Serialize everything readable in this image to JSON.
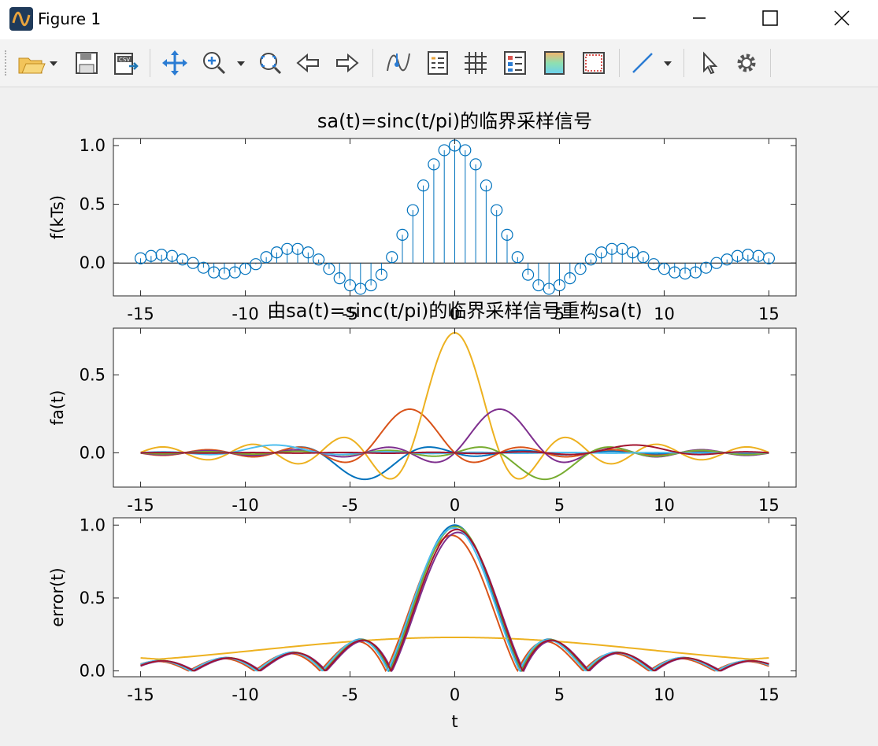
{
  "window": {
    "title": "Figure 1"
  },
  "toolbar": {
    "buttons": [
      "open-file-icon",
      "dropdown-arrow-icon",
      "save-icon",
      "export-csv-icon",
      "pan-icon",
      "zoom-in-icon",
      "dropdown-arrow-icon",
      "zoom-fit-icon",
      "back-arrow-icon",
      "forward-arrow-icon",
      "data-tip-icon",
      "legend-icon",
      "grid-icon",
      "property-inspector-icon",
      "colorbar-icon",
      "axes-box-icon",
      "line-tool-icon",
      "dropdown-arrow-icon",
      "select-pointer-icon",
      "settings-gear-icon"
    ],
    "csv_text": "CSV"
  },
  "colors": {
    "stem": "#0072bd",
    "series": [
      "#0072bd",
      "#d95319",
      "#edb120",
      "#7e2f8e",
      "#77ac30",
      "#4dbeee",
      "#a2142f"
    ]
  },
  "chart_data": [
    {
      "type": "stem",
      "title": "sa(t)=sinc(t/pi)的临界采样信号",
      "xlabel": "",
      "ylabel": "f(kTs)",
      "xlim": [
        -16.3,
        16.3
      ],
      "ylim": [
        -0.28,
        1.06
      ],
      "xticks": [
        -15,
        -10,
        -5,
        0,
        5,
        10,
        15
      ],
      "yticks": [
        0.0,
        0.5,
        1.0
      ],
      "ytick_labels": [
        "0.0",
        "0.5",
        "1.0"
      ],
      "x": [
        -15,
        -14.5,
        -14,
        -13.5,
        -13,
        -12.5,
        -12,
        -11.5,
        -11,
        -10.5,
        -10,
        -9.5,
        -9,
        -8.5,
        -8,
        -7.5,
        -7,
        -6.5,
        -6,
        -5.5,
        -5,
        -4.5,
        -4,
        -3.5,
        -3,
        -2.5,
        -2,
        -1.5,
        -1,
        -0.5,
        0,
        0.5,
        1,
        1.5,
        2,
        2.5,
        3,
        3.5,
        4,
        4.5,
        5,
        5.5,
        6,
        6.5,
        7,
        7.5,
        8,
        8.5,
        9,
        9.5,
        10,
        10.5,
        11,
        11.5,
        12,
        12.5,
        13,
        13.5,
        14,
        14.5,
        15
      ],
      "values": [
        0.04,
        0.06,
        0.07,
        0.06,
        0.03,
        0.0,
        -0.04,
        -0.08,
        -0.09,
        -0.08,
        -0.05,
        -0.01,
        0.05,
        0.09,
        0.12,
        0.12,
        0.09,
        0.03,
        -0.05,
        -0.13,
        -0.19,
        -0.22,
        -0.19,
        -0.1,
        0.05,
        0.24,
        0.45,
        0.66,
        0.84,
        0.96,
        1.0,
        0.96,
        0.84,
        0.66,
        0.45,
        0.24,
        0.05,
        -0.1,
        -0.19,
        -0.22,
        -0.19,
        -0.13,
        -0.05,
        0.03,
        0.09,
        0.12,
        0.12,
        0.09,
        0.05,
        -0.01,
        -0.05,
        -0.08,
        -0.09,
        -0.08,
        -0.04,
        0.0,
        0.03,
        0.06,
        0.07,
        0.06,
        0.04
      ]
    },
    {
      "type": "line",
      "title": "由sa(t)=sinc(t/pi)的临界采样信号重构sa(t)",
      "xlabel": "",
      "ylabel": "fa(t)",
      "xlim": [
        -16.3,
        16.3
      ],
      "ylim": [
        -0.22,
        0.8
      ],
      "xticks": [
        -15,
        -10,
        -5,
        0,
        5,
        10,
        15
      ],
      "yticks": [
        0.0,
        0.5
      ],
      "ytick_labels": [
        "0.0",
        "0.5"
      ],
      "x_range": [
        -15,
        15
      ],
      "series": [
        {
          "center": -4.3,
          "amplitude": -0.17,
          "width": 2.15
        },
        {
          "center": -2.15,
          "amplitude": 0.28,
          "width": 2.15
        },
        {
          "center": 0,
          "amplitude": 0.77,
          "width": 2.15
        },
        {
          "center": 2.15,
          "amplitude": 0.28,
          "width": 2.15
        },
        {
          "center": 4.3,
          "amplitude": -0.17,
          "width": 2.15
        },
        {
          "center": -8.6,
          "amplitude": 0.05,
          "width": 2.15
        },
        {
          "center": 8.6,
          "amplitude": 0.05,
          "width": 2.15
        }
      ]
    },
    {
      "type": "line",
      "title": "",
      "xlabel": "t",
      "ylabel": "error(t)",
      "xlim": [
        -16.3,
        16.3
      ],
      "ylim": [
        -0.04,
        1.05
      ],
      "xticks": [
        -15,
        -10,
        -5,
        0,
        5,
        10,
        15
      ],
      "yticks": [
        0.0,
        0.5,
        1.0
      ],
      "ytick_labels": [
        "0.0",
        "0.5",
        "1.0"
      ],
      "x_range": [
        -15,
        15
      ],
      "series": [
        {
          "shift": 0.0,
          "scale": 1.0
        },
        {
          "shift": -0.15,
          "scale": 0.93
        },
        {
          "shift": 0.0,
          "scale": 0.23,
          "flat": true
        },
        {
          "shift": 0.15,
          "scale": 0.95
        },
        {
          "shift": 0.05,
          "scale": 0.99
        },
        {
          "shift": -0.05,
          "scale": 0.98
        },
        {
          "shift": 0.1,
          "scale": 0.97
        }
      ]
    }
  ]
}
